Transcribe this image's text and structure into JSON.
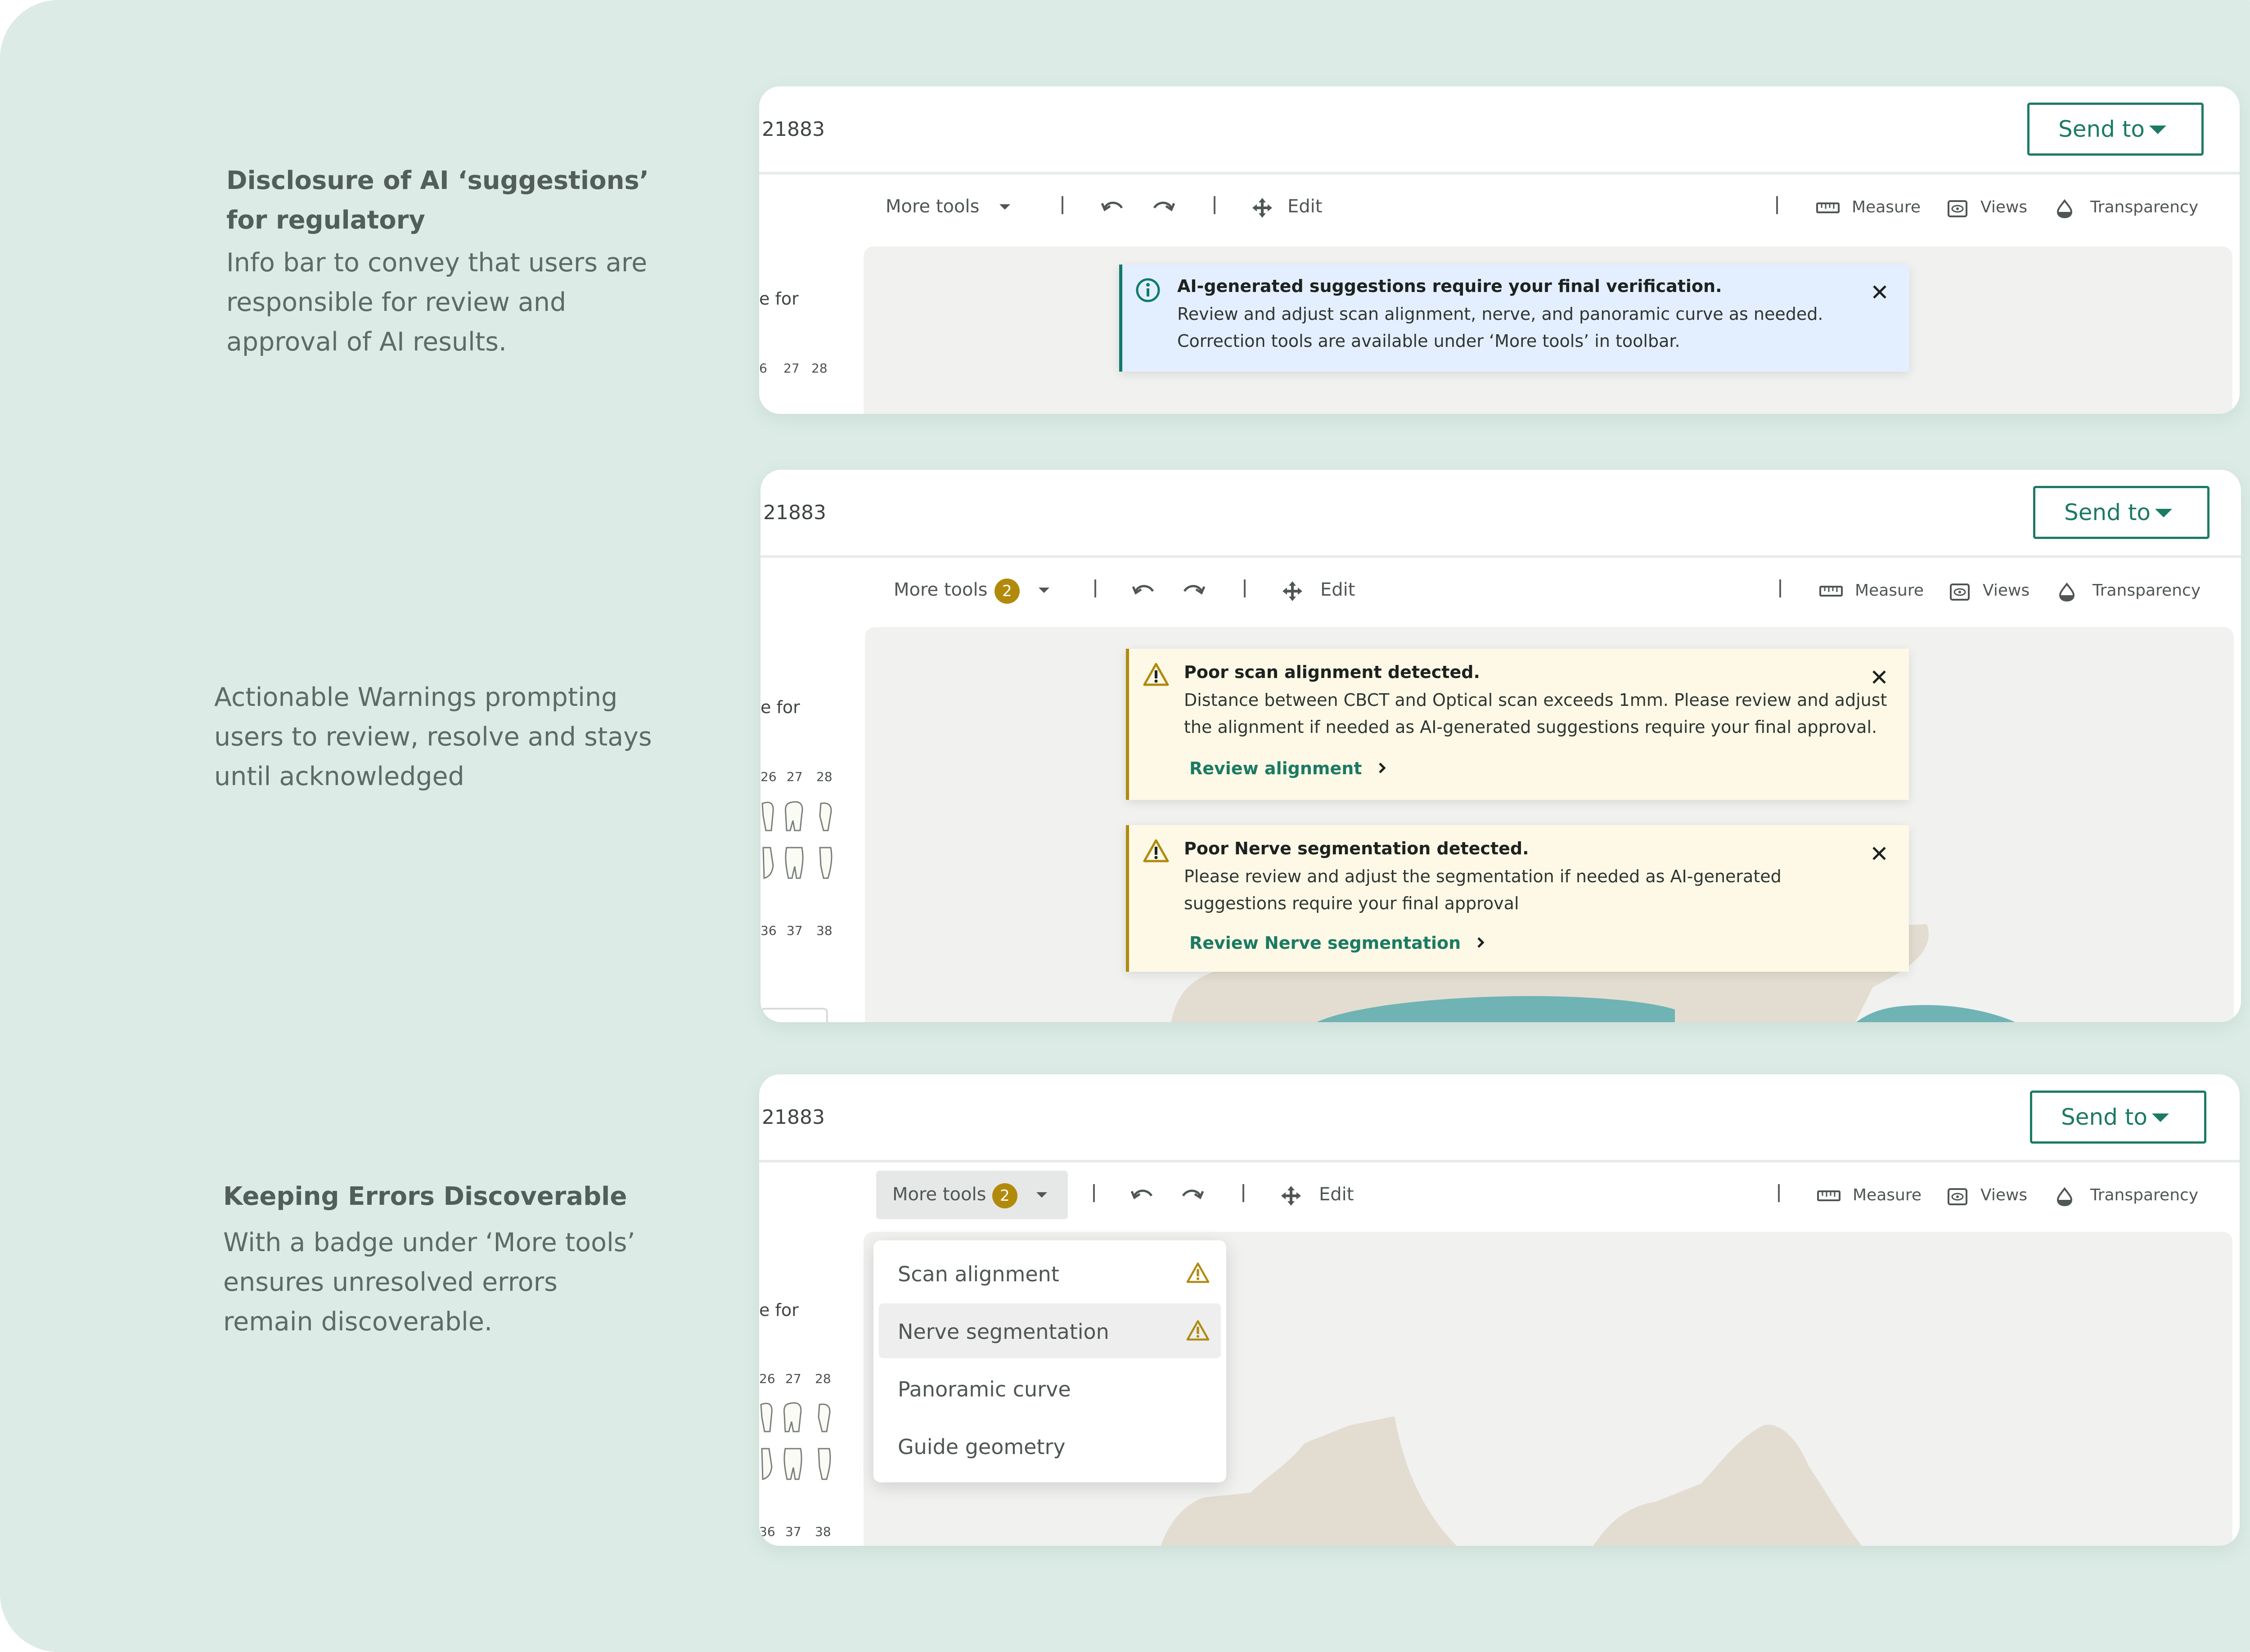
{
  "captions": {
    "c1_title_l1": "Disclosure of AI ‘suggestions’",
    "c1_title_l2": "for regulatory",
    "c1_body_l1": "Info bar to convey that users are",
    "c1_body_l2": "responsible for review and",
    "c1_body_l3": "approval of AI results.",
    "c2_body_l1": "Actionable Warnings prompting",
    "c2_body_l2": "users to review, resolve and stays",
    "c2_body_l3": "until acknowledged",
    "c3_title": "Keeping Errors Discoverable",
    "c3_body_l1": "With a badge under ‘More tools’",
    "c3_body_l2": "ensures unresolved errors",
    "c3_body_l3": "remain discoverable."
  },
  "app": {
    "case_id": "21883",
    "send_to": "Send to",
    "more_tools": "More tools",
    "more_tools_badge": "2",
    "edit": "Edit",
    "measure": "Measure",
    "views": "Views",
    "transparency": "Transparency",
    "side_fragment": "e for",
    "teeth_upper": [
      "6",
      "27",
      "28"
    ],
    "teeth_upper_2": [
      "26",
      "27",
      "28"
    ],
    "teeth_lower": [
      "36",
      "37",
      "38"
    ]
  },
  "info_banner": {
    "title": "AI-generated suggestions require your final verification.",
    "line1": "Review and adjust scan alignment, nerve, and panoramic curve as needed.",
    "line2": "Correction tools are available under ‘More tools’ in toolbar."
  },
  "warning_1": {
    "title": "Poor scan alignment detected.",
    "line1": "Distance between CBCT and Optical scan exceeds 1mm. Please review and adjust",
    "line2": "the alignment if needed as AI-generated suggestions require your final approval.",
    "link": "Review alignment"
  },
  "warning_2": {
    "title": "Poor Nerve segmentation detected.",
    "line1": "Please review and adjust the segmentation if needed as AI-generated",
    "line2": "suggestions require your final approval",
    "link": "Review Nerve segmentation"
  },
  "menu": {
    "items": [
      {
        "label": "Scan alignment",
        "warning": true
      },
      {
        "label": "Nerve segmentation",
        "warning": true
      },
      {
        "label": "Panoramic curve",
        "warning": false
      },
      {
        "label": "Guide geometry",
        "warning": false
      }
    ]
  },
  "colors": {
    "background": "#dcebe5",
    "accent": "#1c7a63",
    "warning": "#b08a10",
    "info_bg": "#e3efff",
    "warn_bg": "#fdf9e6"
  }
}
